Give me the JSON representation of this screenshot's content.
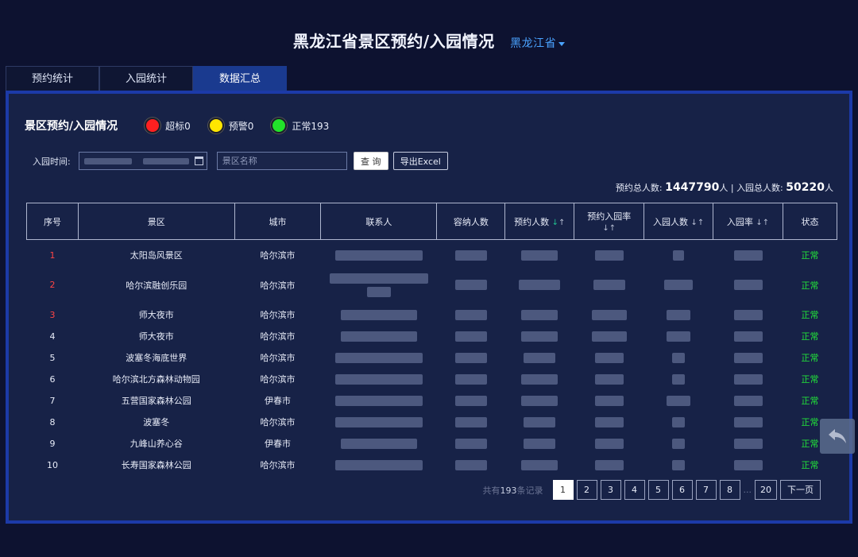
{
  "header": {
    "title": "黑龙江省景区预约/入园情况",
    "region": "黑龙江省"
  },
  "tabs": [
    {
      "label": "预约统计",
      "active": false
    },
    {
      "label": "入园统计",
      "active": false
    },
    {
      "label": "数据汇总",
      "active": true
    }
  ],
  "panel": {
    "title": "景区预约/入园情况",
    "legend": [
      {
        "label": "超标0",
        "color": "#ff2020"
      },
      {
        "label": "预警0",
        "color": "#ffe600"
      },
      {
        "label": "正常193",
        "color": "#22e22a"
      }
    ]
  },
  "filters": {
    "date_label": "入园时间:",
    "name_placeholder": "景区名称",
    "query_label": "查 询",
    "export_label": "导出Excel"
  },
  "totals": {
    "booking_label": "预约总人数:",
    "booking_value": "1447790",
    "unit": "人",
    "separator": "|",
    "entry_label": "入园总人数:",
    "entry_value": "50220"
  },
  "table": {
    "columns": [
      "序号",
      "景区",
      "城市",
      "联系人",
      "容纳人数",
      "预约人数",
      "预约入园率",
      "入园人数",
      "入园率",
      "状态"
    ],
    "rows": [
      {
        "idx": "1",
        "name": "太阳岛风景区",
        "city": "哈尔滨市",
        "status": "正常"
      },
      {
        "idx": "2",
        "name": "哈尔滨融创乐园",
        "city": "哈尔滨市",
        "status": "正常"
      },
      {
        "idx": "3",
        "name": "师大夜市",
        "city": "哈尔滨市",
        "status": "正常"
      },
      {
        "idx": "4",
        "name": "师大夜市",
        "city": "哈尔滨市",
        "status": "正常"
      },
      {
        "idx": "5",
        "name": "波塞冬海底世界",
        "city": "哈尔滨市",
        "status": "正常"
      },
      {
        "idx": "6",
        "name": "哈尔滨北方森林动物园",
        "city": "哈尔滨市",
        "status": "正常"
      },
      {
        "idx": "7",
        "name": "五营国家森林公园",
        "city": "伊春市",
        "status": "正常"
      },
      {
        "idx": "8",
        "name": "波塞冬",
        "city": "哈尔滨市",
        "status": "正常"
      },
      {
        "idx": "9",
        "name": "九峰山养心谷",
        "city": "伊春市",
        "status": "正常"
      },
      {
        "idx": "10",
        "name": "长寿国家森林公园",
        "city": "哈尔滨市",
        "status": "正常"
      }
    ]
  },
  "pager": {
    "total_prefix": "共有",
    "total_count": "193",
    "total_suffix": "条记录",
    "pages": [
      "1",
      "2",
      "3",
      "4",
      "5",
      "6",
      "7",
      "8"
    ],
    "last_page": "20",
    "ellipsis": "...",
    "next_label": "下一页"
  },
  "sort_icons": {
    "down": "↓",
    "up": "↑"
  }
}
